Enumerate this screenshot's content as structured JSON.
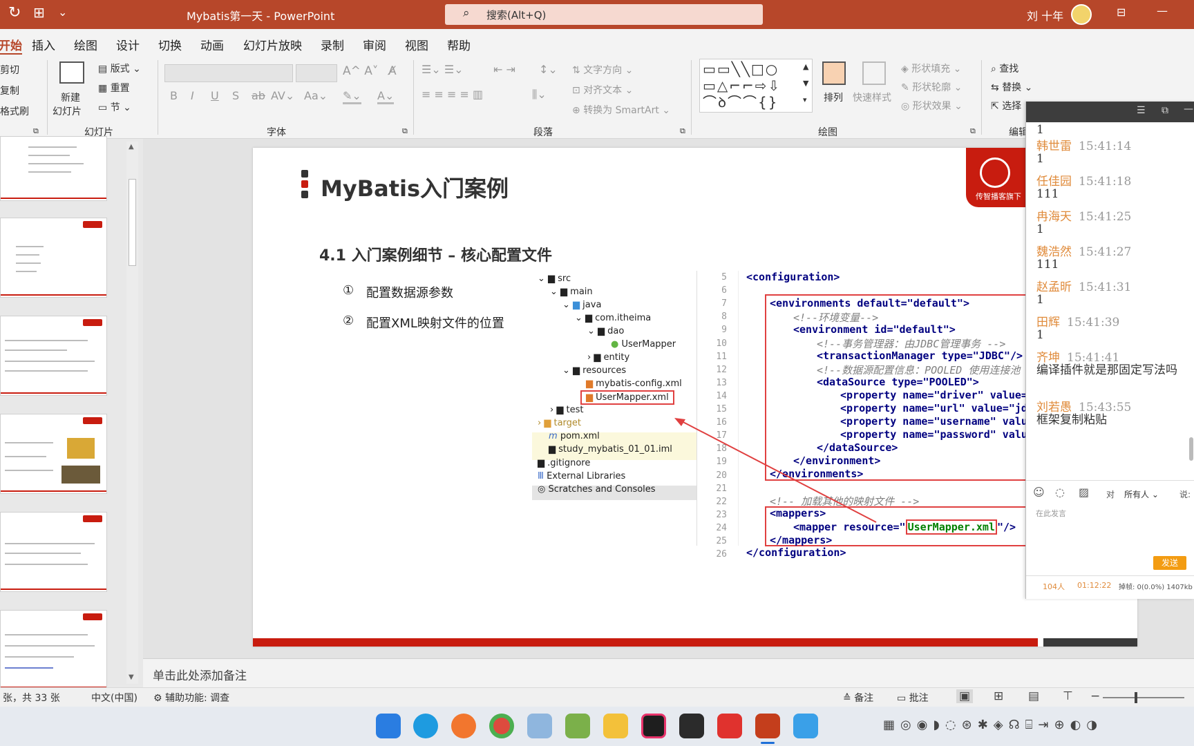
{
  "titlebar": {
    "title": "Mybatis第一天 - PowerPoint",
    "search_placeholder": "搜索(Alt+Q)",
    "user": "刘 十年",
    "color": "#b7472a"
  },
  "menu": [
    "开始",
    "插入",
    "绘图",
    "设计",
    "切换",
    "动画",
    "幻灯片放映",
    "录制",
    "审阅",
    "视图",
    "帮助"
  ],
  "ribbon": {
    "clipboard": [
      "剪切",
      "复制",
      "格式刷"
    ],
    "slides": {
      "new": "新建",
      "new2": "幻灯片",
      "layout": "版式",
      "reset": "重置",
      "section": "节",
      "group": "幻灯片"
    },
    "font": {
      "group": "字体"
    },
    "paragraph": {
      "textdir": "文字方向",
      "align": "对齐文本",
      "smartart": "转换为 SmartArt",
      "group": "段落"
    },
    "drawing": {
      "arrange": "排列",
      "quickstyle": "快速样式",
      "fill": "形状填充",
      "outline": "形状轮廓",
      "effect": "形状效果",
      "group": "绘图"
    },
    "editing": {
      "find": "查找",
      "replace": "替换",
      "select": "选择",
      "group": "编辑"
    }
  },
  "slide": {
    "title": "MyBatis入门案例",
    "subtitle": "4.1  入门案例细节 – 核心配置文件",
    "bullets": [
      {
        "num": "①",
        "text": "配置数据源参数"
      },
      {
        "num": "②",
        "text": "配置XML映射文件的位置"
      }
    ],
    "logo_text": "传智播客旗下",
    "tree": [
      "src",
      "main",
      "java",
      "com.itheima",
      "dao",
      "UserMapper",
      "entity",
      "resources",
      "mybatis-config.xml",
      "UserMapper.xml",
      "test",
      "target",
      "pom.xml",
      "study_mybatis_01_01.iml",
      ".gitignore",
      "External Libraries",
      "Scratches and Consoles"
    ],
    "line_numbers": [
      "5",
      "6",
      "7",
      "8",
      "9",
      "10",
      "11",
      "12",
      "13",
      "14",
      "15",
      "16",
      "17",
      "18",
      "19",
      "20",
      "21",
      "22",
      "23",
      "24",
      "25",
      "26"
    ],
    "code": [
      "<configuration>",
      "<environments default=\"default\">",
      "<!--环境变量-->",
      "<environment id=\"default\">",
      "<!--事务管理器：由JDBC管理事务 -->",
      "<transactionManager type=\"JDBC\"/>",
      "<!--数据源配置信息：POOLED 使用连接池",
      "<dataSource type=\"POOLED\">",
      "<property name=\"driver\" value=",
      "<property name=\"url\" value=\"jd",
      "<property name=\"username\" valu",
      "<property name=\"password\" valu",
      "</dataSource>",
      "</environment>",
      "</environments>",
      "<!-- 加载其他的映射文件 -->",
      "<mappers>",
      "<mapper resource=\"",
      "UserMapper.xml",
      "\"/>",
      "</mappers>",
      "</configuration>"
    ]
  },
  "notes": "单击此处添加备注",
  "status": {
    "slide": "张，共 33 张",
    "lang": "中文(中国)",
    "access": "辅助功能: 调查",
    "notes": "备注",
    "comments": "批注"
  },
  "chat": {
    "messages": [
      {
        "text": "1"
      },
      {
        "name": "韩世雷",
        "time": "15:41:14",
        "text": "1"
      },
      {
        "name": "任佳园",
        "time": "15:41:18",
        "text": "111"
      },
      {
        "name": "冉海天",
        "time": "15:41:25",
        "text": "1"
      },
      {
        "name": "魏浩然",
        "time": "15:41:27",
        "text": "111"
      },
      {
        "name": "赵孟昕",
        "time": "15:41:31",
        "text": "1"
      },
      {
        "name": "田辉",
        "time": "15:41:39",
        "text": "1"
      },
      {
        "name": "齐坤",
        "time": "15:41:41",
        "text": "编译插件就是那固定写法吗"
      },
      {
        "name": "刘若愚",
        "time": "15:43:55",
        "text": "框架复制粘贴"
      }
    ],
    "to_label": "对",
    "to_value": "所有人",
    "say": "说:",
    "input_placeholder": "在此发言",
    "send": "发送",
    "count": "104人",
    "duration": "01:12:22",
    "drop": "掉帧: 0(0.0%) 1407kb"
  }
}
